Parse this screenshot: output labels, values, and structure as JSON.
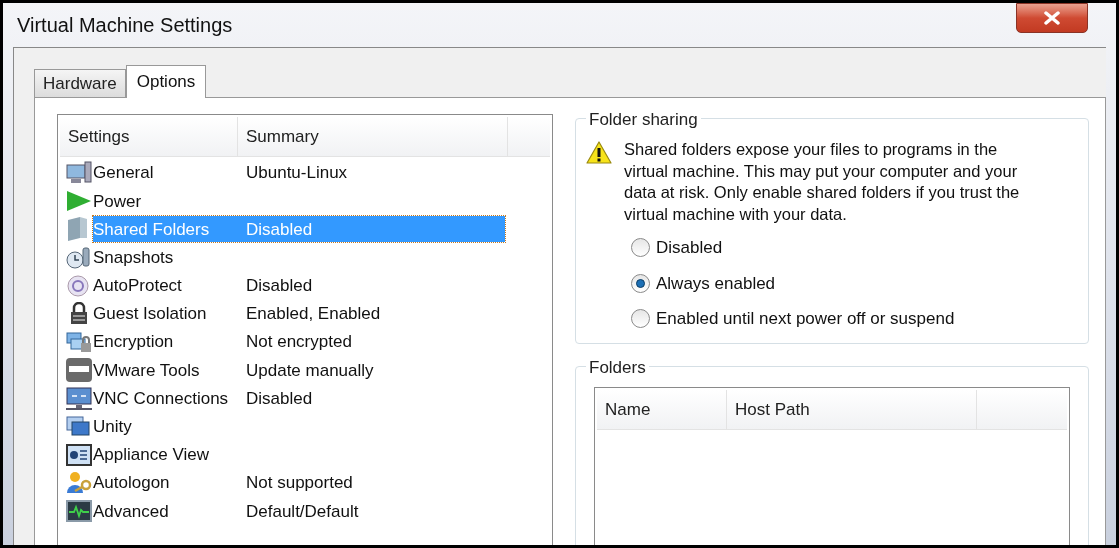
{
  "window": {
    "title": "Virtual Machine Settings"
  },
  "tabs": [
    {
      "label": "Hardware",
      "selected": false
    },
    {
      "label": "Options",
      "selected": true
    }
  ],
  "settings_table": {
    "columns": [
      "Settings",
      "Summary"
    ],
    "rows": [
      {
        "setting": "General",
        "summary": "Ubuntu-Linux",
        "selected": false
      },
      {
        "setting": "Power",
        "selected": false
      },
      {
        "setting": "Shared Folders",
        "summary": "Disabled",
        "selected": true
      },
      {
        "setting": "Snapshots",
        "selected": false
      },
      {
        "setting": "AutoProtect",
        "summary": "Disabled",
        "selected": false
      },
      {
        "setting": "Guest Isolation",
        "summary": "Enabled, Enabled",
        "selected": false
      },
      {
        "setting": "Encryption",
        "summary": "Not encrypted",
        "selected": false
      },
      {
        "setting": "VMware Tools",
        "summary": "Update manually",
        "selected": false
      },
      {
        "setting": "VNC Connections",
        "summary": "Disabled",
        "selected": false
      },
      {
        "setting": "Unity",
        "selected": false
      },
      {
        "setting": "Appliance View",
        "selected": false
      },
      {
        "setting": "Autologon",
        "summary": "Not supported",
        "selected": false
      },
      {
        "setting": "Advanced",
        "summary": "Default/Default",
        "selected": false
      }
    ]
  },
  "folder_sharing": {
    "title": "Folder sharing",
    "warning": "Shared folders expose your files to programs in the virtual machine. This may put your computer and your data at risk. Only enable shared folders if you trust the virtual machine with your data.",
    "options": [
      {
        "label": "Disabled",
        "selected": false
      },
      {
        "label": "Always enabled",
        "selected": true
      },
      {
        "label": "Enabled until next power off or suspend",
        "selected": false
      }
    ]
  },
  "folders": {
    "title": "Folders",
    "columns": [
      "Name",
      "Host Path"
    ]
  }
}
